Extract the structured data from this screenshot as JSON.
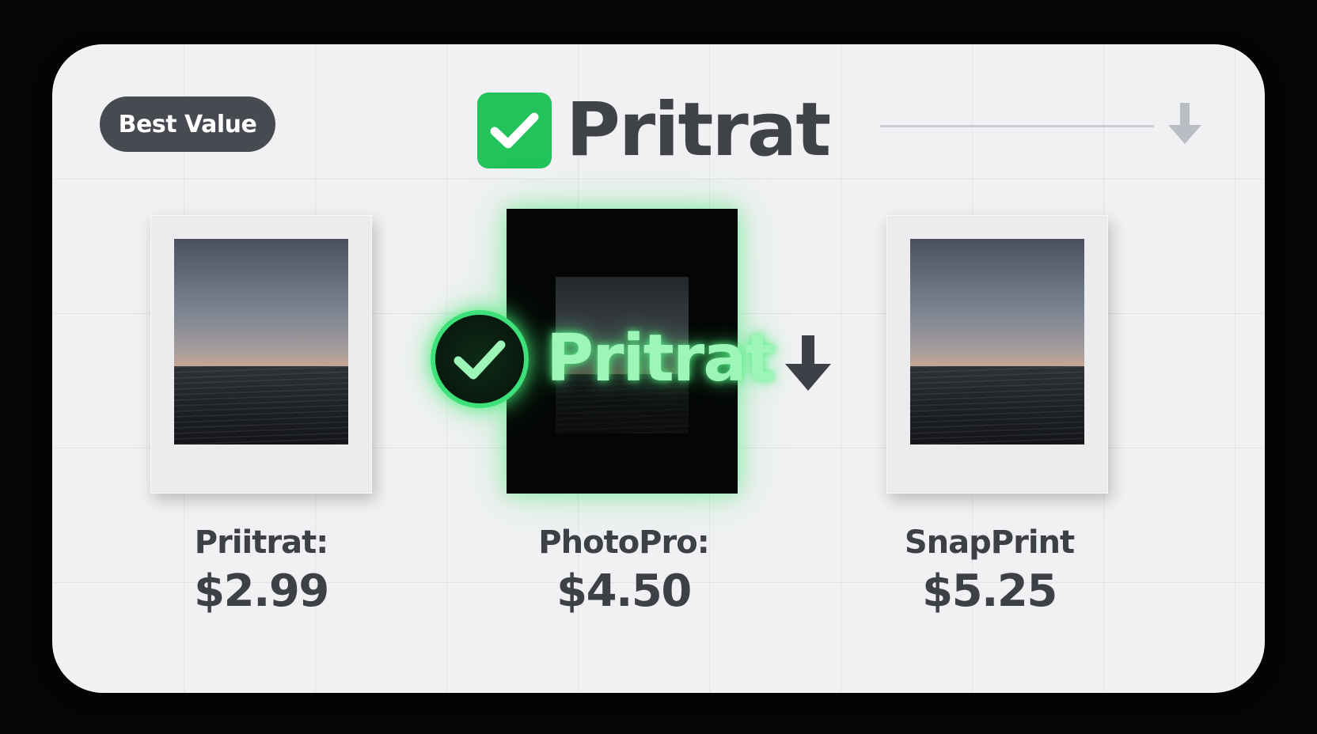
{
  "badge": {
    "label": "Best Value"
  },
  "header": {
    "logo_text": "Pritrat",
    "logo_icon": "check-icon",
    "arrow_icon": "arrow-down-icon"
  },
  "highlight": {
    "brand_text": "Pritrat",
    "icon": "check-circle-icon",
    "arrow_icon": "arrow-down-icon"
  },
  "products": [
    {
      "name": "Priitrat:",
      "price": "$2.99"
    },
    {
      "name": "PhotoPro:",
      "price": "$4.50"
    },
    {
      "name": "SnapPrint",
      "price": "$5.25"
    }
  ],
  "colors": {
    "accent_green": "#21c35a",
    "glow_green": "#3ee07a",
    "text_dark": "#3d4046",
    "badge_bg": "#474a51"
  }
}
